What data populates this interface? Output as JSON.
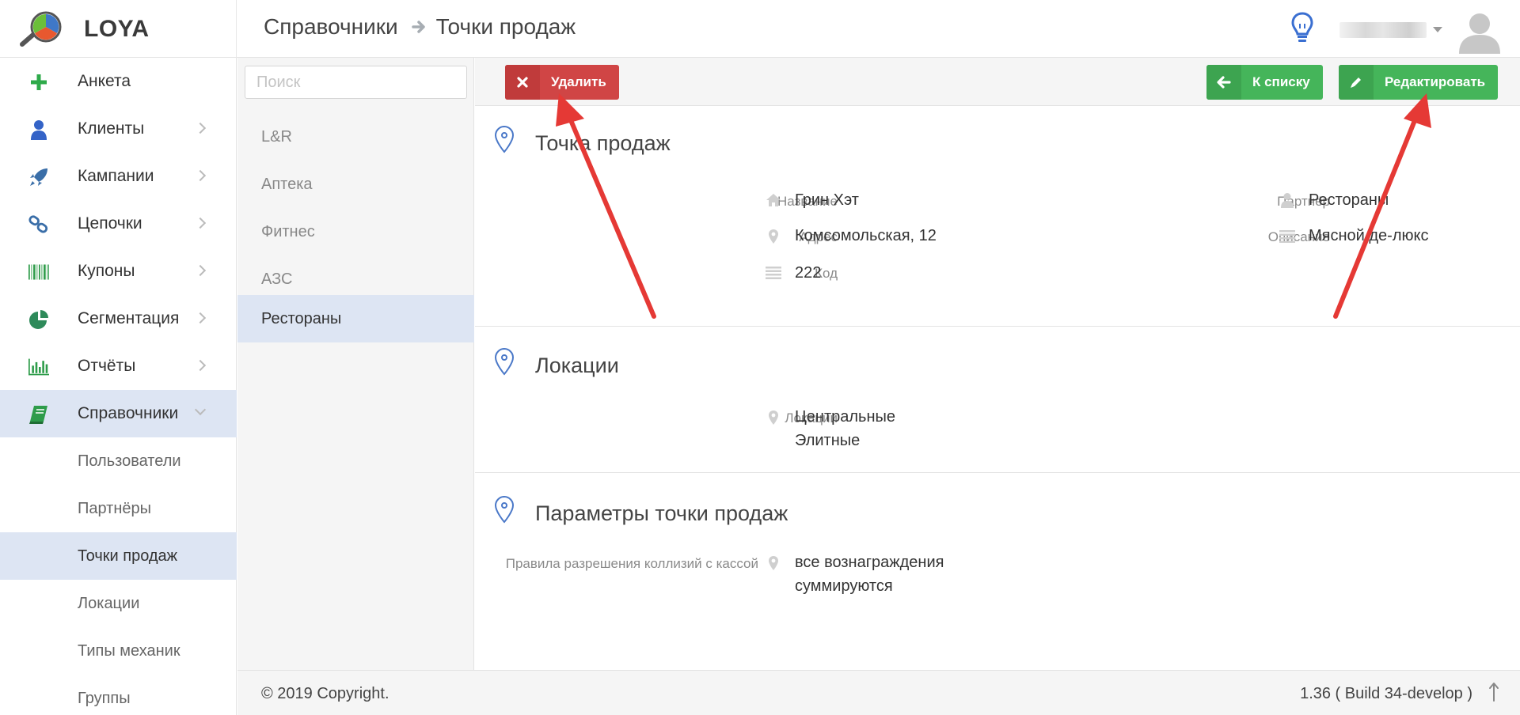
{
  "app": {
    "logo_text": "LOYA"
  },
  "breadcrumb": {
    "parent": "Справочники",
    "current": "Точки продаж"
  },
  "sidebar": {
    "items": [
      {
        "label": "Анкета",
        "icon": "plus-icon"
      },
      {
        "label": "Клиенты",
        "icon": "user-icon"
      },
      {
        "label": "Кампании",
        "icon": "rocket-icon"
      },
      {
        "label": "Цепочки",
        "icon": "link-icon"
      },
      {
        "label": "Купоны",
        "icon": "barcode-icon"
      },
      {
        "label": "Сегментация",
        "icon": "pie-chart-icon"
      },
      {
        "label": "Отчёты",
        "icon": "bar-chart-icon"
      },
      {
        "label": "Справочники",
        "icon": "book-icon"
      }
    ],
    "subitems": [
      {
        "label": "Пользователи"
      },
      {
        "label": "Партнёры"
      },
      {
        "label": "Точки продаж"
      },
      {
        "label": "Локации"
      },
      {
        "label": "Типы механик"
      },
      {
        "label": "Группы"
      }
    ]
  },
  "list": {
    "search_placeholder": "Поиск",
    "items": [
      {
        "label": "L&R"
      },
      {
        "label": "Аптека"
      },
      {
        "label": "Фитнес"
      },
      {
        "label": "АЗС"
      },
      {
        "label": "Рестораны"
      }
    ]
  },
  "toolbar": {
    "delete_label": "Удалить",
    "back_label": "К списку",
    "edit_label": "Редактировать"
  },
  "sections": {
    "point": {
      "title": "Точка продаж",
      "name_label": "Название",
      "name_value": "Грин Хэт",
      "address_label": "Адрес",
      "address_value": "Комсомольская, 12",
      "code_label": "Код",
      "code_value": "222",
      "partner_label": "Партнёр",
      "partner_value": "Рестораны",
      "description_label": "Описание",
      "description_value": "Мясной де-люкс"
    },
    "locations": {
      "title": "Локации",
      "label": "Локации",
      "value_1": "Центральные",
      "value_2": "Элитные"
    },
    "params": {
      "title": "Параметры точки продаж",
      "label": "Правила разрешения коллизий с кассой",
      "value_1": "все вознаграждения",
      "value_2": "суммируются"
    }
  },
  "footer": {
    "copyright": "© 2019 Copyright.",
    "version": "1.36 ( Build 34-develop )"
  },
  "colors": {
    "danger": "#d04545",
    "success": "#45b55a",
    "active_bg": "#dde5f3",
    "annotation_arrow": "#e53935"
  }
}
